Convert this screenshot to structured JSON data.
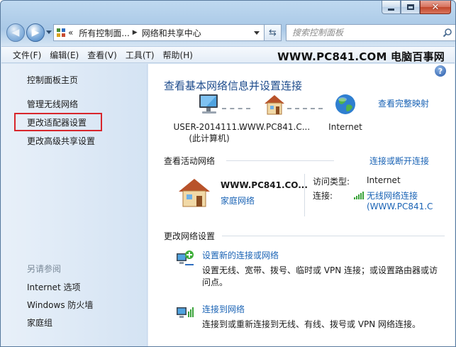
{
  "window": {
    "caption_close": "✕",
    "caption_min": "",
    "caption_max": ""
  },
  "address": {
    "crumb_overflow": "«",
    "crumbs": [
      "所有控制面...",
      "网络和共享中心"
    ],
    "search_placeholder": "搜索控制面板"
  },
  "menu": {
    "items": [
      "文件(F)",
      "编辑(E)",
      "查看(V)",
      "工具(T)",
      "帮助(H)"
    ],
    "watermark": "WWW.PC841.COM 电脑百事网"
  },
  "left": {
    "home": "控制面板主页",
    "links": [
      "管理无线网络",
      "更改适配器设置",
      "更改高级共享设置"
    ],
    "see_also_title": "另请参阅",
    "see_also": [
      "Internet 选项",
      "Windows 防火墙",
      "家庭组"
    ]
  },
  "main": {
    "help": "?",
    "title": "查看基本网络信息并设置连接",
    "full_map": "查看完整映射",
    "nodes": {
      "pc_line1": "USER-2014111...",
      "pc_line2": "(此计算机)",
      "router": "WWW.PC841.C...",
      "internet": "Internet"
    },
    "active_header": "查看活动网络",
    "connect_disconnect": "连接或断开连接",
    "active": {
      "name": "WWW.PC841.CO...",
      "type": "家庭网络",
      "access_label": "访问类型:",
      "access_value": "Internet",
      "conn_label": "连接:",
      "conn_value_line1": "无线网络连接",
      "conn_value_line2": "(WWW.PC841.C"
    },
    "change_header": "更改网络设置",
    "tasks": [
      {
        "link": "设置新的连接或网络",
        "desc": "设置无线、宽带、拨号、临时或 VPN 连接；或设置路由器或访问点。"
      },
      {
        "link": "连接到网络",
        "desc": "连接到或重新连接到无线、有线、拨号或 VPN 网络连接。"
      }
    ]
  }
}
